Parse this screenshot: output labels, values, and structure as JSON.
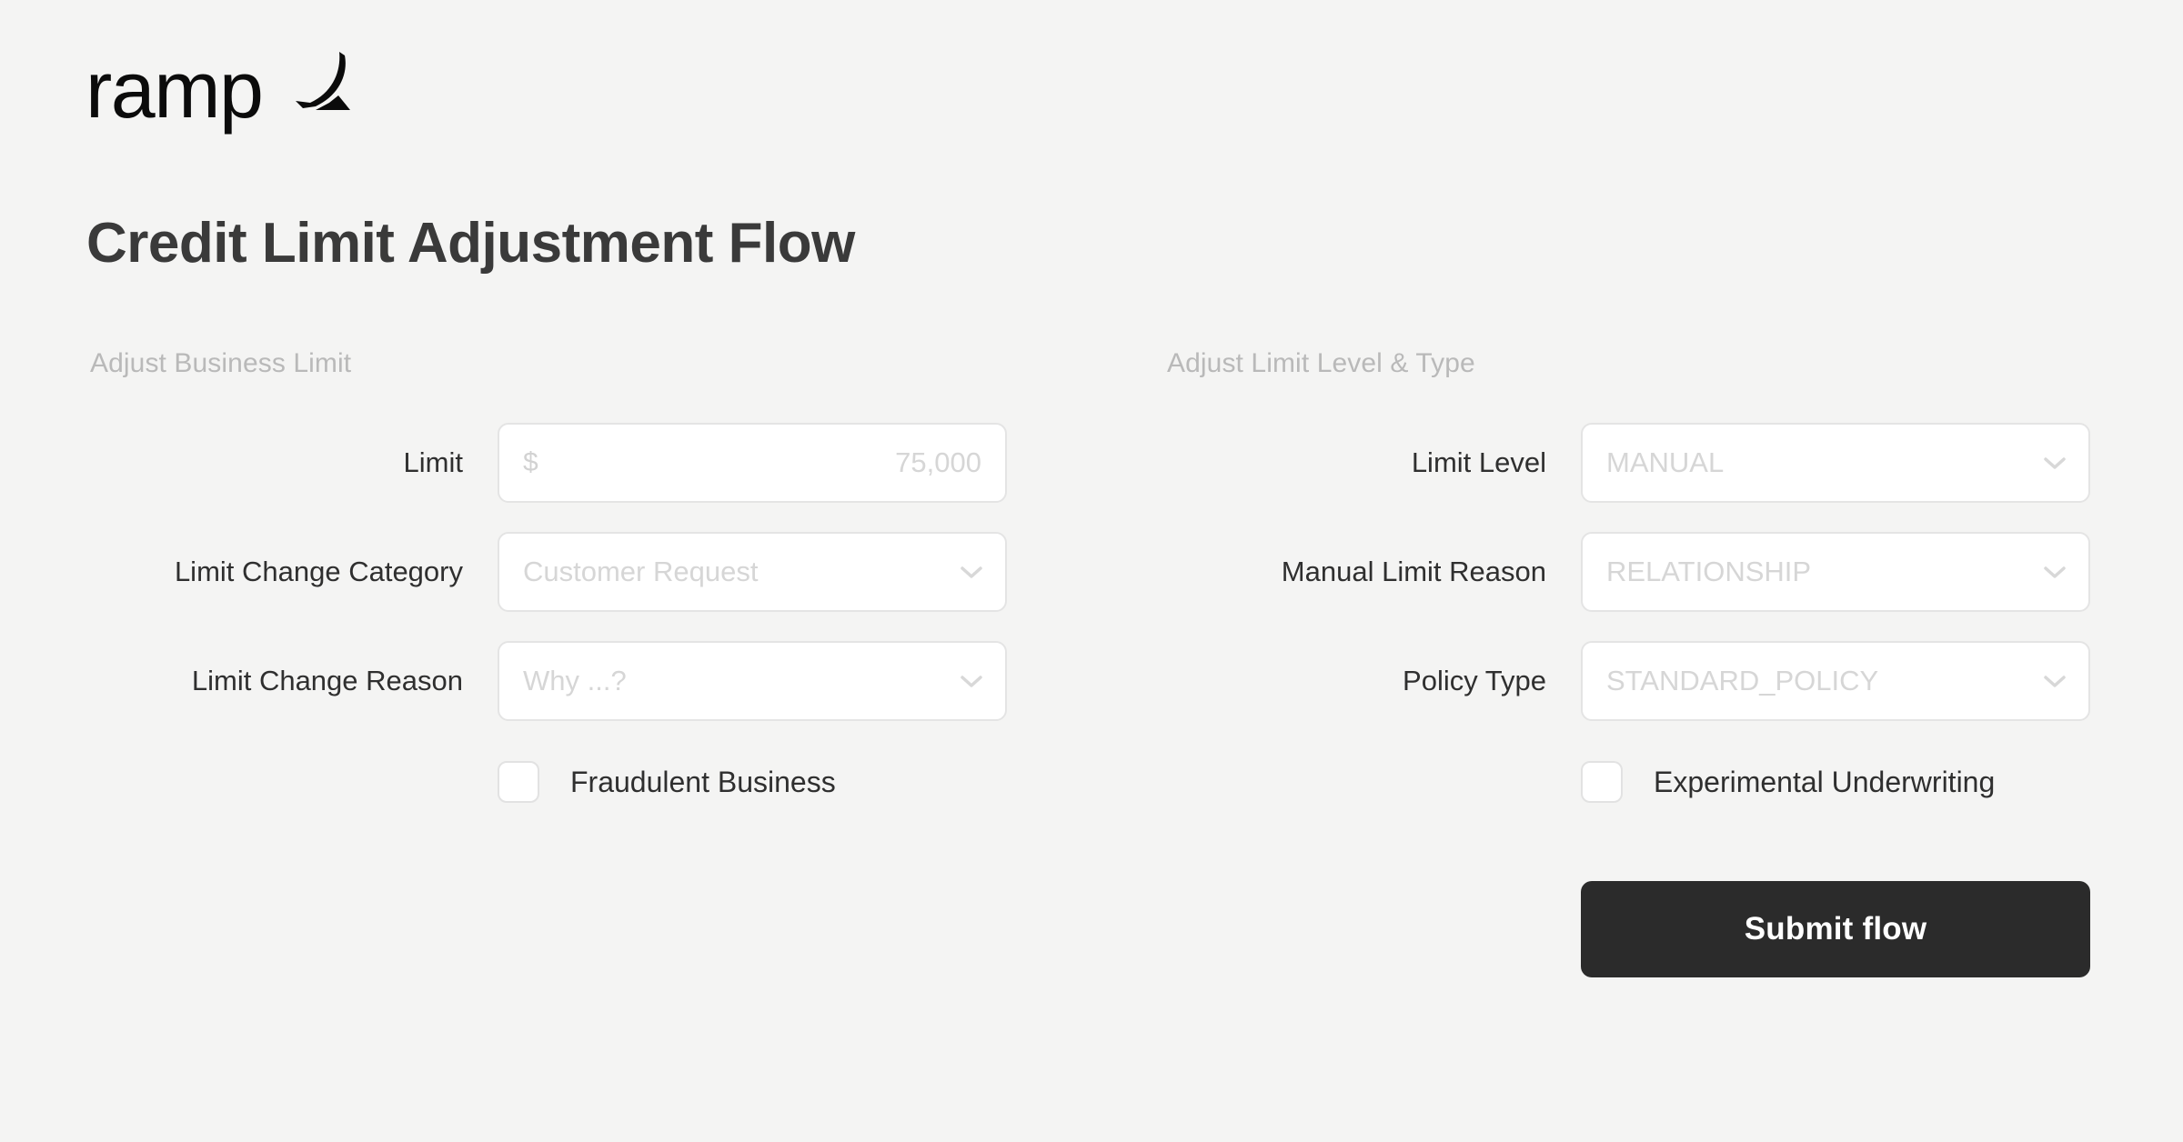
{
  "brand": {
    "wordmark": "ramp",
    "logo_mark_icon": "ramp-swoosh-icon",
    "logo_color": "#0b0b0b"
  },
  "page": {
    "title": "Credit Limit Adjustment Flow",
    "background_color": "#f4f4f3",
    "title_color": "#3a3a3a"
  },
  "left_column": {
    "heading": "Adjust Business Limit",
    "fields": [
      {
        "label": "Limit",
        "type": "text",
        "prefix": "$",
        "placeholder": "75,000",
        "value": "",
        "align": "right"
      },
      {
        "label": "Limit Change Category",
        "type": "select",
        "placeholder": "Customer Request",
        "value": "",
        "chevron_icon": "chevron-down-icon"
      },
      {
        "label": "Limit Change Reason",
        "type": "select",
        "placeholder": "Why ...?",
        "value": "",
        "chevron_icon": "chevron-down-icon"
      }
    ],
    "checkbox": {
      "label": "Fraudulent Business",
      "checked": false
    }
  },
  "right_column": {
    "heading": "Adjust Limit Level & Type",
    "fields": [
      {
        "label": "Limit Level",
        "type": "select",
        "placeholder": "MANUAL",
        "value": "",
        "chevron_icon": "chevron-down-icon"
      },
      {
        "label": "Manual Limit Reason",
        "type": "select",
        "placeholder": "RELATIONSHIP",
        "value": "",
        "chevron_icon": "chevron-down-icon"
      },
      {
        "label": "Policy Type",
        "type": "select",
        "placeholder": "STANDARD_POLICY",
        "value": "",
        "chevron_icon": "chevron-down-icon"
      }
    ],
    "checkbox": {
      "label": "Experimental Underwriting",
      "checked": false
    },
    "submit_label": "Submit flow",
    "submit_color": "#2b2b2b"
  }
}
